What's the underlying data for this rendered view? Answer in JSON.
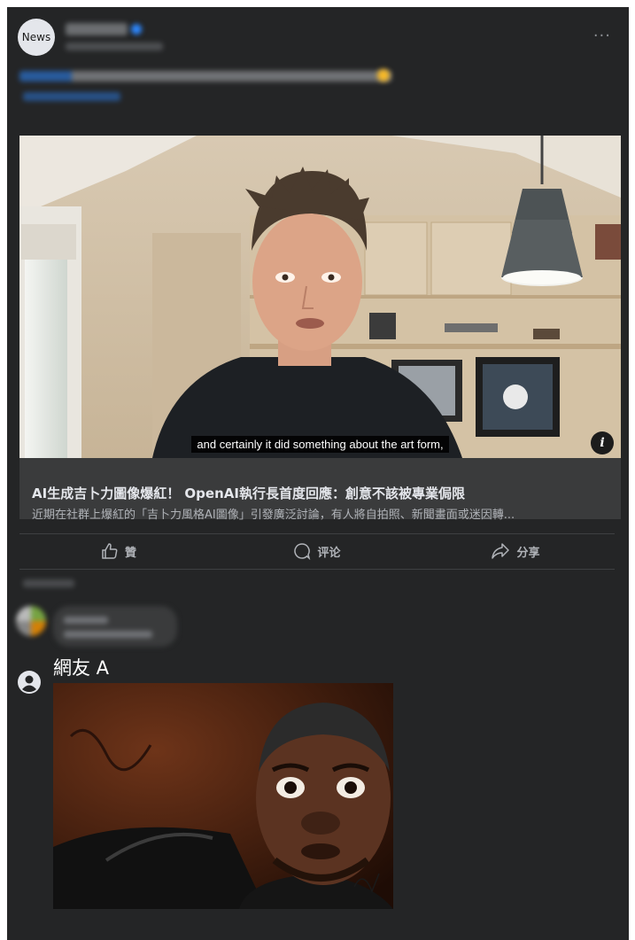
{
  "post": {
    "avatar_text": "News",
    "more_icon": "more-horizontal-icon"
  },
  "video": {
    "subtitle": "and certainly it did something about the art form,",
    "info_glyph": "i"
  },
  "link": {
    "title": "AI生成吉卜力圖像爆紅！ OpenAI執行長首度回應：創意不該被專業侷限",
    "description": "近期在社群上爆紅的「吉卜力風格AI圖像」引發廣泛討論，有人將自拍照、新聞畫面或迷因轉..."
  },
  "actions": {
    "like_label": "贊",
    "comment_label": "评论",
    "share_label": "分享"
  },
  "reply": {
    "user_name": "網友 A"
  },
  "colors": {
    "card_bg": "#242526",
    "link_bg": "#3a3b3c",
    "text_primary": "#e4e6eb",
    "text_secondary": "#b0b3b8",
    "accent": "#2d88ff"
  }
}
